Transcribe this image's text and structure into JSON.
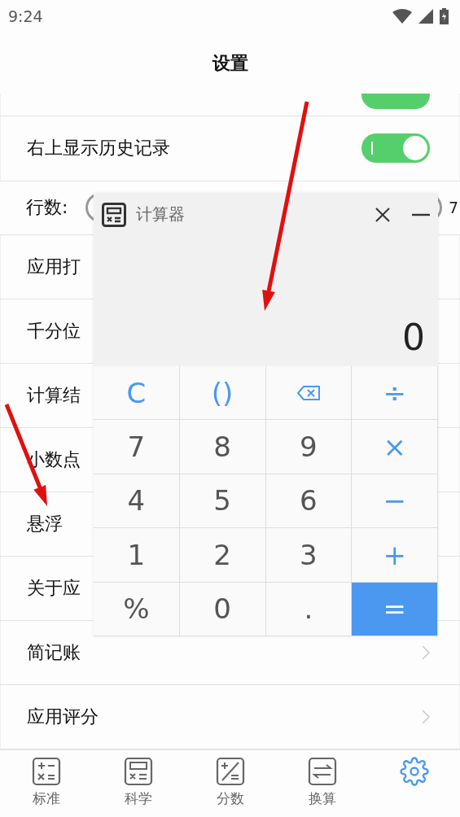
{
  "status_bar": {
    "time": "9:24"
  },
  "header": {
    "title": "设置"
  },
  "settings": [
    {
      "kind": "toggle",
      "on": true
    },
    {
      "kind": "toggle",
      "label": "右上显示历史记录",
      "on": true
    },
    {
      "kind": "slider",
      "label": "行数:",
      "reading": "7"
    },
    {
      "kind": "plain",
      "label": "应用打"
    },
    {
      "kind": "plain",
      "label": "千分位"
    },
    {
      "kind": "plain",
      "label": "计算结"
    },
    {
      "kind": "plain",
      "label": "小数点"
    },
    {
      "kind": "plain",
      "label": "悬浮"
    },
    {
      "kind": "plain",
      "label": "关于应"
    },
    {
      "kind": "link",
      "label": "简记账"
    },
    {
      "kind": "link",
      "label": "应用评分"
    }
  ],
  "calculator": {
    "title": "计算器",
    "display": "0",
    "keys": [
      {
        "kind": "function",
        "label": "C"
      },
      {
        "kind": "function",
        "label": "()"
      },
      {
        "kind": "backspace"
      },
      {
        "kind": "operator",
        "label": "÷"
      },
      {
        "kind": "digit",
        "label": "7"
      },
      {
        "kind": "digit",
        "label": "8"
      },
      {
        "kind": "digit",
        "label": "9"
      },
      {
        "kind": "operator",
        "label": "×"
      },
      {
        "kind": "digit",
        "label": "4"
      },
      {
        "kind": "digit",
        "label": "5"
      },
      {
        "kind": "digit",
        "label": "6"
      },
      {
        "kind": "operator",
        "label": "−"
      },
      {
        "kind": "digit",
        "label": "1"
      },
      {
        "kind": "digit",
        "label": "2"
      },
      {
        "kind": "digit",
        "label": "3"
      },
      {
        "kind": "operator",
        "label": "+"
      },
      {
        "kind": "digit",
        "label": "%"
      },
      {
        "kind": "digit",
        "label": "0"
      },
      {
        "kind": "digit",
        "label": "."
      },
      {
        "kind": "equals",
        "label": "="
      }
    ]
  },
  "bottom_nav": [
    {
      "kind": "standard",
      "label": "标准",
      "selected": false
    },
    {
      "kind": "scientific",
      "label": "科学",
      "selected": false
    },
    {
      "kind": "fraction",
      "label": "分数",
      "selected": false
    },
    {
      "kind": "convert",
      "label": "换算",
      "selected": false
    },
    {
      "kind": "settings",
      "selected": true
    }
  ]
}
